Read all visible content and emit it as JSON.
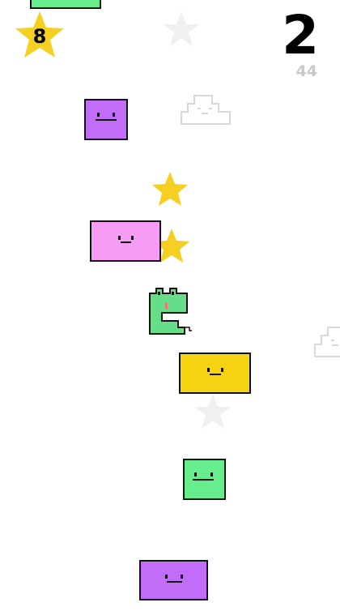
{
  "hud": {
    "stars_collected": "8",
    "score": "2",
    "best_score": "44"
  },
  "colors": {
    "star": "#f5cf22",
    "ghost_star": "#f0f0f0",
    "block_purple": "#c26df7",
    "block_pink": "#f79cf5",
    "block_yellow": "#f5d311",
    "block_green": "#66ed8e",
    "player_green": "#66dd88",
    "outline": "#111111",
    "ghost_outline": "#d8d8d8"
  },
  "icons": {
    "counter": "star-icon",
    "player": "snake-character-icon",
    "collectible": "star-icon",
    "decoration": "pixel-cloud-icon"
  }
}
